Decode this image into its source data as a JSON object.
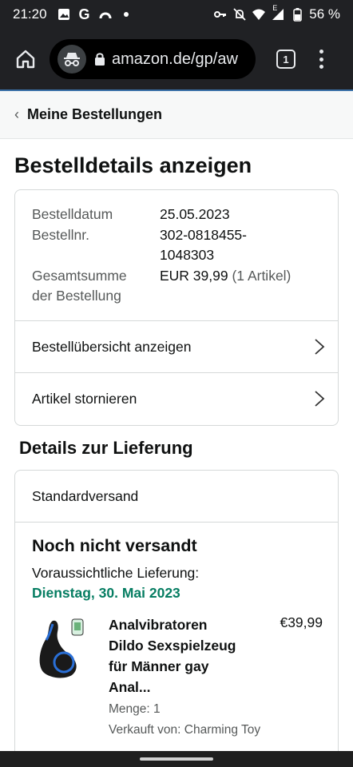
{
  "status_bar": {
    "time": "21:20",
    "left_icons": [
      "gallery-icon",
      "google-icon",
      "app-icon",
      "dot-icon"
    ],
    "right_icons": [
      "vpn-key-icon",
      "mute-icon",
      "wifi-icon",
      "signal-icon",
      "battery-icon"
    ],
    "signal_label": "E",
    "battery": "56 %"
  },
  "browser": {
    "url": "amazon.de/gp/aw",
    "tab_count": "1"
  },
  "breadcrumb": {
    "label": "Meine Bestellungen"
  },
  "page": {
    "title": "Bestelldetails anzeigen"
  },
  "order": {
    "date_label": "Bestelldatum",
    "date_value": "25.05.2023",
    "number_label": "Bestellnr.",
    "number_value_line1": "302-0818455-",
    "number_value_line2": "1048303",
    "total_label_line1": "Gesamtsumme",
    "total_label_line2": "der Bestellung",
    "total_value": "EUR 39,99",
    "total_items": "(1 Artikel)",
    "links": [
      {
        "label": "Bestellübersicht anzeigen"
      },
      {
        "label": "Artikel stornieren"
      }
    ]
  },
  "delivery": {
    "section_title": "Details zur Lieferung",
    "method": "Standardversand",
    "status": "Noch nicht versandt",
    "estimate_label": "Voraussichtliche Lieferung:",
    "estimate_date": "Dienstag, 30. Mai 2023",
    "estimate_color": "#067d62"
  },
  "product": {
    "title_lines": [
      "Analvibratoren",
      "Dildo Sexspielzeug",
      "für Männer gay",
      "Anal..."
    ],
    "price": "€39,99",
    "quantity": "Menge: 1",
    "seller": "Verkauft von: Charming Toy"
  }
}
